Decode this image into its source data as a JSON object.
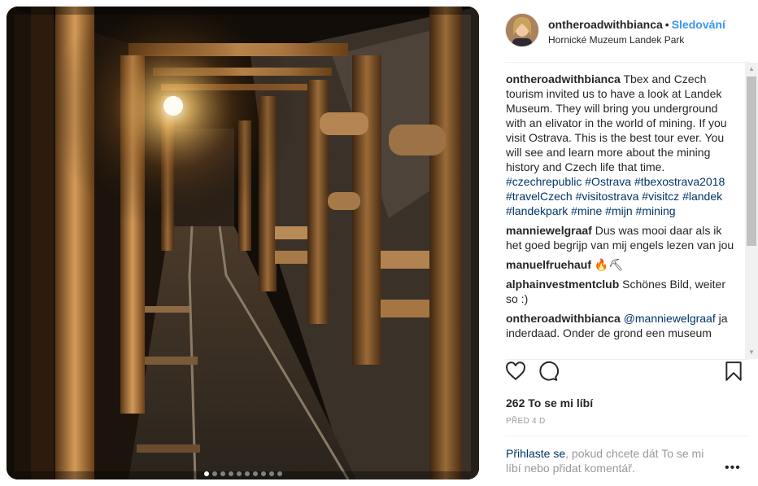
{
  "post": {
    "username": "ontheroadwithbianca",
    "separator": "•",
    "follow_label": "Sledování",
    "location": "Hornické Muzeum Landek Park",
    "carousel_count": 10,
    "carousel_active": 1
  },
  "comments": [
    {
      "user": "ontheroadwithbianca",
      "text": "Tbex and Czech tourism invited us to have a look at Landek Museum. They will bring you underground with an elivator in the world of mining. If you visit Ostrava. This is the best tour ever. You will see and learn more about the mining history and Czech life that time.",
      "tags": "#czechrepublic #Ostrava #tbexostrava2018 #travelCzech #visitostrava #visitcz #landek #landekpark #mine #mijn #mining"
    },
    {
      "user": "manniewelgraaf",
      "text": "Dus was mooi daar als ik het goed begrijp van mij engels lezen van jou"
    },
    {
      "user": "manuelfruehauf",
      "text": "🔥⛏"
    },
    {
      "user": "alphainvestmentclub",
      "text": "Schönes Bild, weiter so :)"
    },
    {
      "user": "ontheroadwithbianca",
      "mention": "@manniewelgraaf",
      "text": "ja inderdaad. Onder de grond een museum"
    }
  ],
  "icons": {
    "like": "heart-icon",
    "comment": "comment-icon",
    "save": "bookmark-icon",
    "more": "more-options-icon"
  },
  "likes_label": "262 To se mi líbí",
  "date_label": "PŘED 4 D",
  "login": {
    "link": "Přihlaste se",
    "rest": ", pokud chcete dát To se mi líbí nebo přidat komentář."
  },
  "more_label": "•••",
  "colors": {
    "link": "#3897f0",
    "tag": "#003569",
    "muted": "#999999"
  }
}
